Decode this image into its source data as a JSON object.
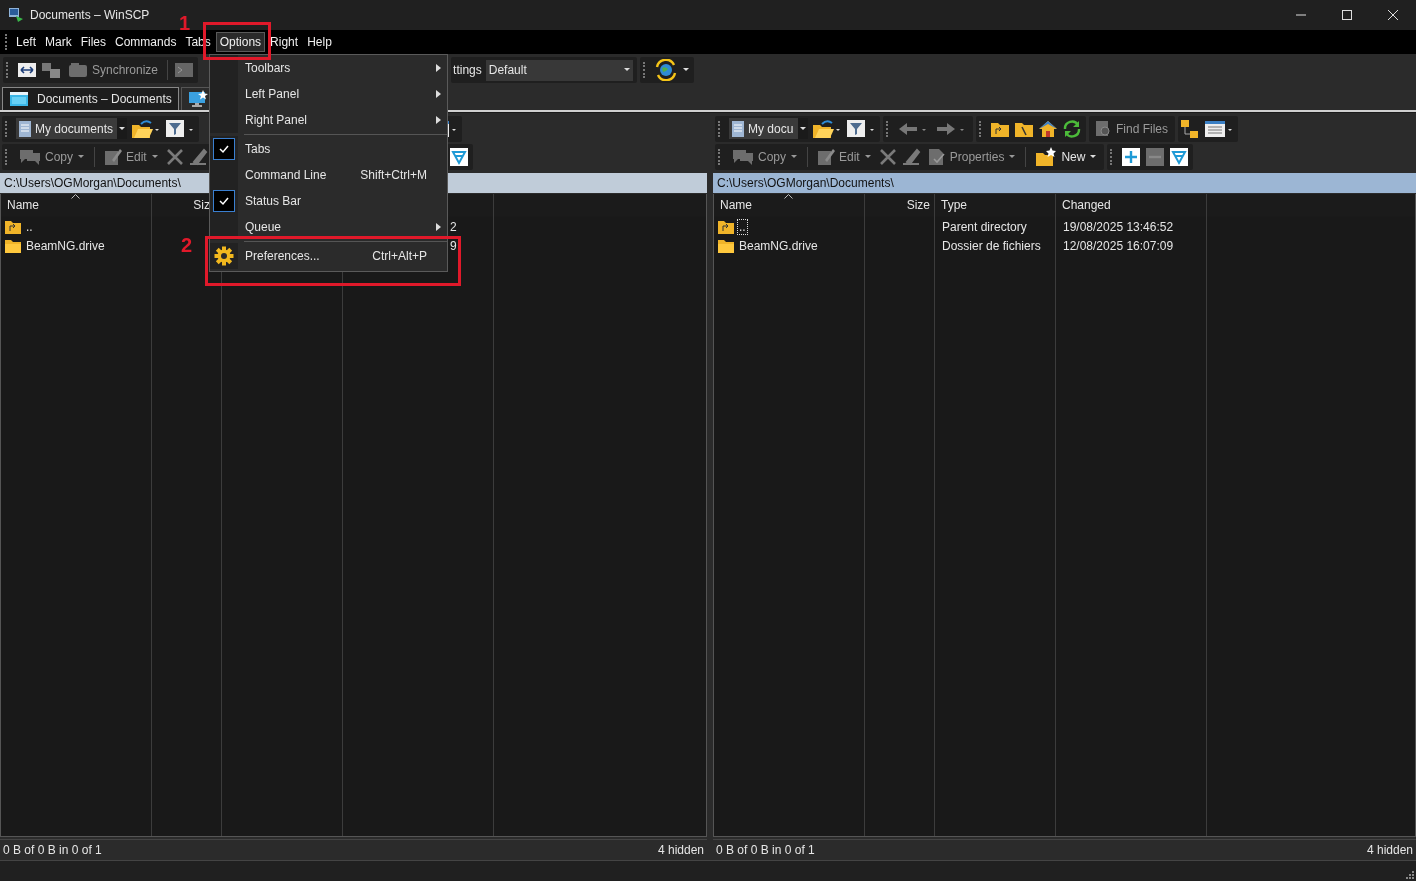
{
  "window": {
    "title": "Documents – WinSCP"
  },
  "menubar": [
    {
      "label": "Left",
      "selected": false
    },
    {
      "label": "Mark",
      "selected": false
    },
    {
      "label": "Files",
      "selected": false
    },
    {
      "label": "Commands",
      "selected": false
    },
    {
      "label": "Tabs",
      "selected": false
    },
    {
      "label": "Options",
      "selected": true
    },
    {
      "label": "Right",
      "selected": false
    },
    {
      "label": "Help",
      "selected": false
    }
  ],
  "toolbar": {
    "synchronize": {
      "label": "Synchronize",
      "disabled": true
    },
    "transfer_settings_label": "ttings",
    "transfer_settings_value": "Default"
  },
  "tabs": [
    {
      "label": "Documents – Documents",
      "selected": true
    },
    {
      "selected": false
    }
  ],
  "left_panel": {
    "location": "My documents",
    "buttons": [
      {
        "kind": "copy",
        "label": "Copy",
        "disabled": true
      },
      {
        "kind": "edit",
        "label": "Edit",
        "disabled": true
      }
    ],
    "path": "C:\\Users\\OGMorgan\\Documents\\",
    "active": false,
    "columns": [
      {
        "label": "Name"
      },
      {
        "label": "Siz"
      },
      {},
      {}
    ],
    "rows": [
      {
        "kind": "parent",
        "name": "..",
        "changed": "2",
        "focused": false
      },
      {
        "kind": "folder",
        "name": "BeamNG.drive",
        "changed": "9",
        "focused": false
      }
    ],
    "status": "0 B of 0 B in 0 of 1",
    "hidden": "4 hidden"
  },
  "right_panel": {
    "location": "My docu",
    "buttons": [
      {
        "kind": "copy",
        "label": "Copy",
        "disabled": true
      },
      {
        "kind": "edit",
        "label": "Edit",
        "disabled": true
      },
      {
        "kind": "properties",
        "label": "Properties",
        "disabled": true
      },
      {
        "kind": "new",
        "label": "New",
        "disabled": false
      }
    ],
    "find": {
      "label": "Find Files",
      "disabled": true
    },
    "path": "C:\\Users\\OGMorgan\\Documents\\",
    "active": true,
    "columns": [
      {
        "label": "Name"
      },
      {
        "label": "Size"
      },
      {
        "label": "Type"
      },
      {
        "label": "Changed"
      }
    ],
    "rows": [
      {
        "kind": "parent",
        "name": "..",
        "type": "Parent directory",
        "changed": "19/08/2025 13:46:52",
        "focused": true
      },
      {
        "kind": "folder",
        "name": "BeamNG.drive",
        "type": "Dossier de fichiers",
        "changed": "12/08/2025 16:07:09",
        "focused": false
      }
    ],
    "status": "0 B of 0 B in 0 of 1",
    "hidden": "4 hidden"
  },
  "options_menu": [
    {
      "kind": "plain",
      "label": "Toolbars",
      "checked": false,
      "submenu": true
    },
    {
      "kind": "plain",
      "label": "Left Panel",
      "checked": false,
      "submenu": true
    },
    {
      "kind": "plain",
      "label": "Right Panel",
      "checked": false,
      "submenu": true
    },
    {
      "kind": "separator"
    },
    {
      "kind": "plain",
      "label": "Tabs",
      "checked": true,
      "submenu": false
    },
    {
      "kind": "plain",
      "label": "Command Line",
      "shortcut": "Shift+Ctrl+M",
      "checked": false,
      "submenu": false
    },
    {
      "kind": "plain",
      "label": "Status Bar",
      "checked": true,
      "submenu": false
    },
    {
      "kind": "plain",
      "label": "Queue",
      "checked": false,
      "submenu": true
    },
    {
      "kind": "separator"
    },
    {
      "kind": "gear",
      "label": "Preferences...",
      "shortcut": "Ctrl+Alt+P",
      "checked": false,
      "submenu": false
    }
  ],
  "annotations": [
    {
      "label": "1"
    },
    {
      "label": "2"
    }
  ]
}
